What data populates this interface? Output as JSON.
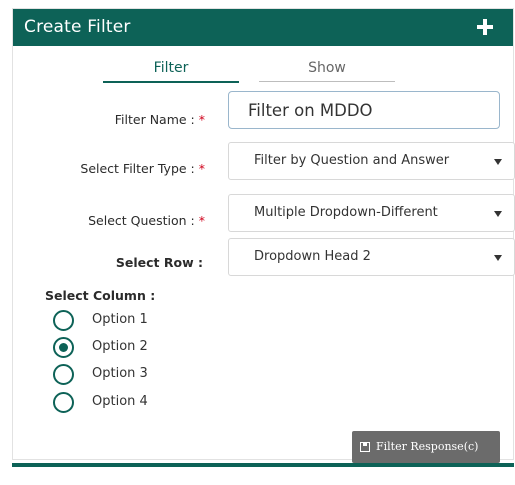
{
  "header": {
    "title": "Create Filter"
  },
  "tabs": [
    {
      "label": "Filter"
    },
    {
      "label": "Show"
    }
  ],
  "form": {
    "filter_name": {
      "label": "Filter Name :",
      "required": "*",
      "value": "Filter on MDDO"
    },
    "filter_type": {
      "label": "Select Filter Type :",
      "required": "*",
      "value": "Filter by Question and Answer"
    },
    "question": {
      "label": "Select Question :",
      "required": "*",
      "value": "Multiple Dropdown-Different"
    },
    "row": {
      "label": "Select Row :",
      "value": "Dropdown Head 2"
    }
  },
  "column": {
    "label": "Select Column :",
    "options": [
      {
        "label": "Option 1",
        "checked": false
      },
      {
        "label": "Option 2",
        "checked": true
      },
      {
        "label": "Option 3",
        "checked": false
      },
      {
        "label": "Option 4",
        "checked": false
      }
    ]
  },
  "actions": {
    "filter_response_label": "Filter Response(c)"
  },
  "colors": {
    "primary": "#0d6257",
    "required": "#d0021b",
    "button": "#6b6b6b"
  }
}
